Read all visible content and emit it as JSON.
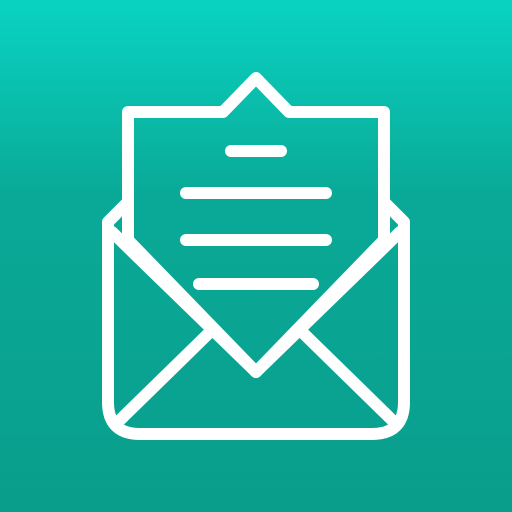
{
  "app_icon": {
    "icon": "open-envelope-letter-icon",
    "background_gradient": [
      "#0ad3c2",
      "#0aa997",
      "#099e8c"
    ],
    "stroke_color": "#ffffff"
  }
}
